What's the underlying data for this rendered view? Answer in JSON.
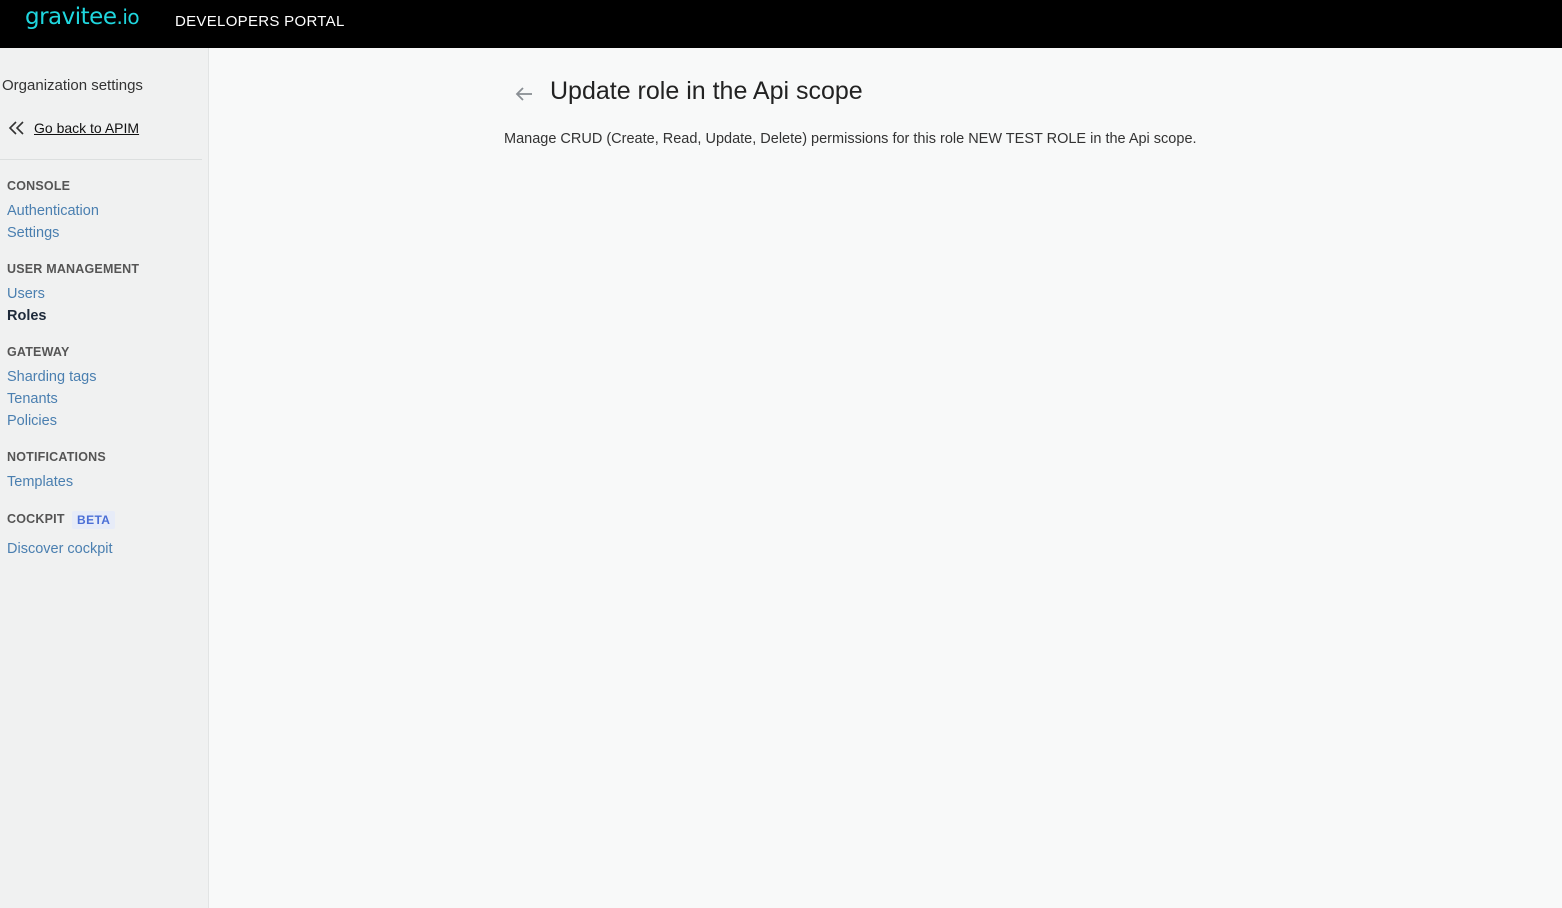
{
  "header": {
    "logo_main": "gravitee",
    "logo_suffix": ".io",
    "portal_title": "DEVELOPERS PORTAL"
  },
  "sidebar": {
    "title": "Organization settings",
    "go_back": "Go back to APIM",
    "sections": [
      {
        "title": "CONSOLE",
        "items": [
          {
            "label": "Authentication"
          },
          {
            "label": "Settings"
          }
        ]
      },
      {
        "title": "USER MANAGEMENT",
        "items": [
          {
            "label": "Users"
          },
          {
            "label": "Roles",
            "active": true
          }
        ]
      },
      {
        "title": "GATEWAY",
        "items": [
          {
            "label": "Sharding tags"
          },
          {
            "label": "Tenants"
          },
          {
            "label": "Policies"
          }
        ]
      },
      {
        "title": "NOTIFICATIONS",
        "items": [
          {
            "label": "Templates"
          }
        ]
      },
      {
        "title": "COCKPIT",
        "badge": "BETA",
        "items": [
          {
            "label": "Discover cockpit"
          }
        ]
      }
    ]
  },
  "main": {
    "title": "Update role in the Api scope",
    "description": "Manage CRUD (Create, Read, Update, Delete) permissions for this role NEW TEST ROLE in the Api scope."
  },
  "colors": {
    "topbar": "#000000",
    "logo": "#1fd6de",
    "link": "#4a7fb0",
    "badge_text": "#4b6fd6"
  }
}
